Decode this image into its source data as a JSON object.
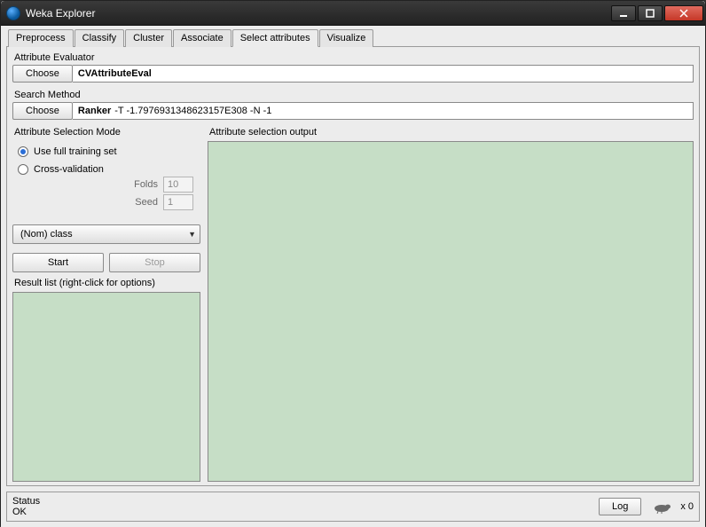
{
  "window": {
    "title": "Weka Explorer"
  },
  "tabs": [
    "Preprocess",
    "Classify",
    "Cluster",
    "Associate",
    "Select attributes",
    "Visualize"
  ],
  "active_tab": 4,
  "attribute_evaluator": {
    "label": "Attribute Evaluator",
    "choose": "Choose",
    "name": "CVAttributeEval",
    "args": ""
  },
  "search_method": {
    "label": "Search Method",
    "choose": "Choose",
    "name": "Ranker",
    "args": "-T -1.7976931348623157E308 -N -1"
  },
  "selection_mode": {
    "label": "Attribute Selection Mode",
    "full": "Use full training set",
    "cv": "Cross-validation",
    "folds_label": "Folds",
    "folds_value": "10",
    "seed_label": "Seed",
    "seed_value": "1",
    "selected": "full"
  },
  "class_dropdown": {
    "value": "(Nom) class"
  },
  "buttons": {
    "start": "Start",
    "stop": "Stop"
  },
  "result_list": {
    "label": "Result list (right-click for options)"
  },
  "output": {
    "label": "Attribute selection output"
  },
  "status": {
    "label": "Status",
    "value": "OK",
    "log": "Log",
    "counter": "x 0"
  }
}
